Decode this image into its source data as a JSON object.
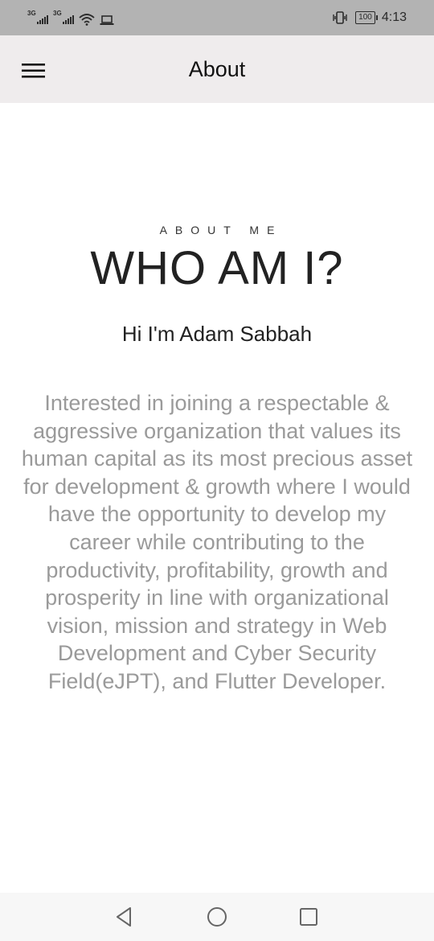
{
  "status_bar": {
    "network_1": "3G",
    "network_2": "3G",
    "battery_level": "100",
    "time": "4:13"
  },
  "app_bar": {
    "title": "About",
    "menu_icon": "hamburger-menu-icon"
  },
  "about": {
    "eyebrow": "ABOUT ME",
    "headline": "WHO AM I?",
    "greeting": "Hi I'm Adam Sabbah",
    "bio": "Interested in joining a respectable & aggressive organization that values its human capital as its most precious asset for development & growth where I would have the opportunity to develop my career while contributing to the productivity, profitability, growth and prosperity in line with organizational vision, mission and strategy in Web Development and Cyber Security Field(eJPT), and Flutter Developer."
  },
  "nav_bar": {
    "back_icon": "back-triangle-icon",
    "home_icon": "home-circle-icon",
    "recents_icon": "recents-square-icon"
  },
  "colors": {
    "status_bar_bg": "#b3b3b3",
    "app_bar_bg": "#efeced",
    "bio_text": "#9a9a9a",
    "heading_text": "#222222"
  }
}
